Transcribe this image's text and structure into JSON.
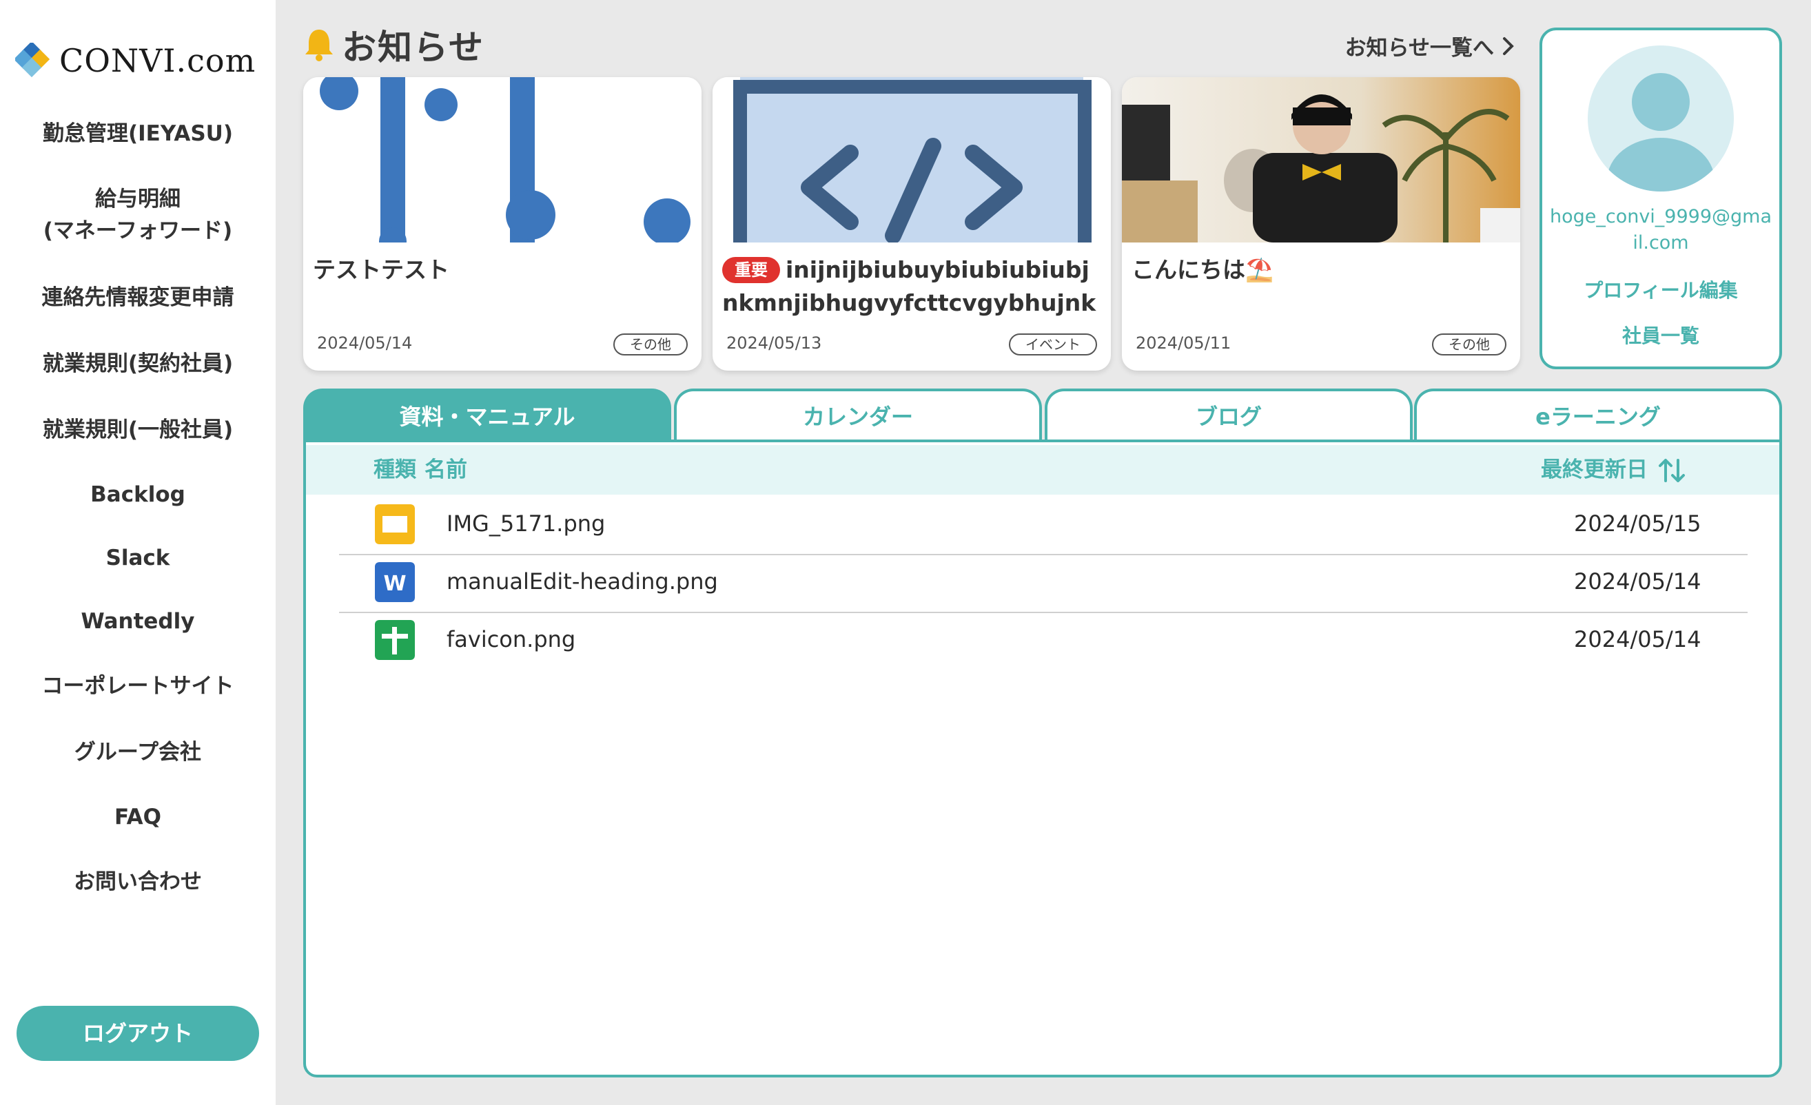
{
  "brand": {
    "name": "CONVI.com"
  },
  "sidebar": {
    "items": [
      {
        "label": "勤怠管理(IEYASU)"
      },
      {
        "label": "給与明細"
      },
      {
        "label": "(マネーフォワード)"
      },
      {
        "label": "連絡先情報変更申請"
      },
      {
        "label": "就業規則(契約社員)"
      },
      {
        "label": "就業規則(一般社員)"
      },
      {
        "label": "Backlog"
      },
      {
        "label": "Slack"
      },
      {
        "label": "Wantedly"
      },
      {
        "label": "コーポレートサイト"
      },
      {
        "label": "グループ会社"
      },
      {
        "label": "FAQ"
      },
      {
        "label": "お問い合わせ"
      }
    ],
    "logout_label": "ログアウト"
  },
  "news": {
    "title": "お知らせ",
    "more_label": "お知らせ一覧へ",
    "cards": [
      {
        "title": "テストテスト",
        "date": "2024/05/14",
        "tag": "その他"
      },
      {
        "badge": "重要",
        "title": "inijnijbiubuybiubiubiubjnkmnjibhugvyfcttcvgybhujnkmjiugvyfctrx…",
        "date": "2024/05/13",
        "tag": "イベント"
      },
      {
        "title": "こんにちは",
        "emoji": "⛱️",
        "date": "2024/05/11",
        "tag": "その他"
      }
    ]
  },
  "profile": {
    "email": "hoge_convi_9999@gmail.com",
    "edit_label": "プロフィール編集",
    "staff_label": "社員一覧"
  },
  "tabs": [
    {
      "label": "資料・マニュアル",
      "active": true
    },
    {
      "label": "カレンダー"
    },
    {
      "label": "ブログ"
    },
    {
      "label": "eラーニング"
    }
  ],
  "table": {
    "col_type": "種類",
    "col_name": "名前",
    "col_date": "最終更新日",
    "rows": [
      {
        "type": "slides",
        "name": "IMG_5171.png",
        "date": "2024/05/15"
      },
      {
        "type": "word",
        "name": "manualEdit-heading.png",
        "date": "2024/05/14"
      },
      {
        "type": "sheet",
        "name": "favicon.png",
        "date": "2024/05/14"
      }
    ]
  },
  "colors": {
    "accent": "#4ab3ae",
    "danger": "#e0322e",
    "brand_blue": "#2a6fb8"
  }
}
